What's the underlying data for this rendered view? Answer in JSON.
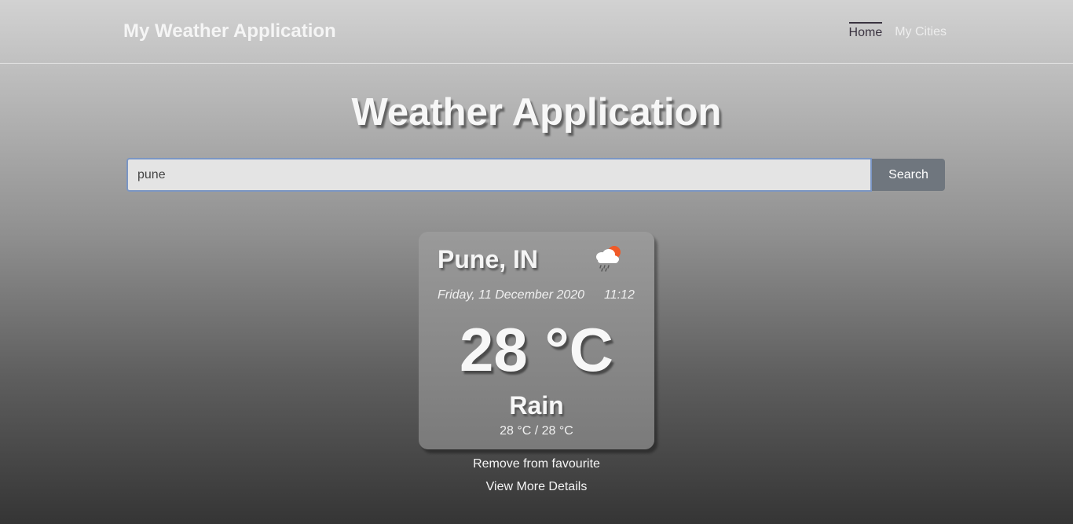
{
  "navbar": {
    "brand": "My Weather Application",
    "links": [
      {
        "label": "Home",
        "active": true
      },
      {
        "label": "My Cities",
        "active": false
      }
    ]
  },
  "main": {
    "title": "Weather Application",
    "search": {
      "value": "pune",
      "button_label": "Search"
    }
  },
  "weather_card": {
    "city": "Pune, IN",
    "icon": "rain-cloud-sun-icon",
    "date": "Friday, 11 December 2020",
    "time": "11:12",
    "temperature": "28 °C",
    "condition": "Rain",
    "min_max": "28 °C / 28 °C"
  },
  "actions": {
    "remove_favourite": "Remove from favourite",
    "view_details": "View More Details"
  },
  "colors": {
    "accent_sun": "#f05a28",
    "search_button": "#6f767e",
    "input_border": "#7b96c4"
  }
}
